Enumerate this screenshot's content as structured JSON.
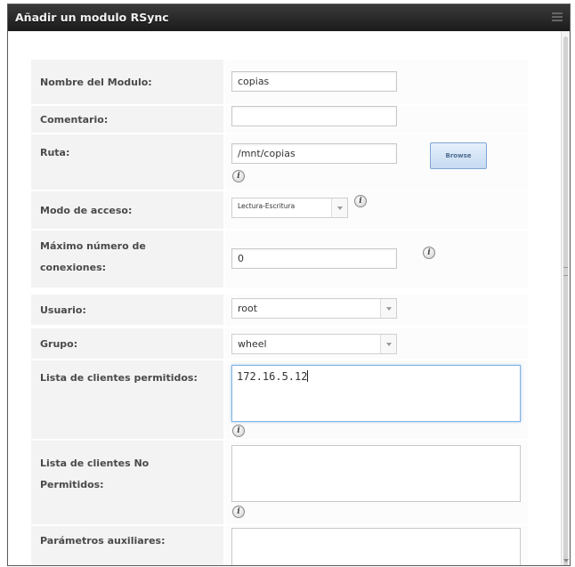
{
  "dialog": {
    "title": "Añadir un modulo RSync"
  },
  "fields": {
    "nombre": {
      "label": "Nombre del Modulo:",
      "value": "copias"
    },
    "comentario": {
      "label": "Comentario:",
      "value": ""
    },
    "ruta": {
      "label": "Ruta:",
      "value": "/mnt/copias",
      "browse_label": "Browse"
    },
    "modo": {
      "label": "Modo de acceso:",
      "value": "Lectura-Escritura"
    },
    "max_conexiones": {
      "label": "Máximo número de conexiones:",
      "value": "0"
    },
    "usuario": {
      "label": "Usuario:",
      "value": "root"
    },
    "grupo": {
      "label": "Grupo:",
      "value": "wheel"
    },
    "clientes_permitidos": {
      "label": "Lista de clientes permitidos:",
      "value": "172.16.5.12"
    },
    "clientes_no_permitidos": {
      "label": "Lista de clientes No Permitidos:",
      "value": ""
    },
    "parametros": {
      "label": "Parámetros auxiliares:",
      "value": ""
    }
  },
  "icons": {
    "info": "info-icon",
    "info_glyph": "i"
  },
  "colors": {
    "titlebar": "#1b1b1b",
    "label_bg": "#f3f3f3",
    "browse_button": "#c5daf1",
    "focus_border": "#7fb2e5"
  }
}
